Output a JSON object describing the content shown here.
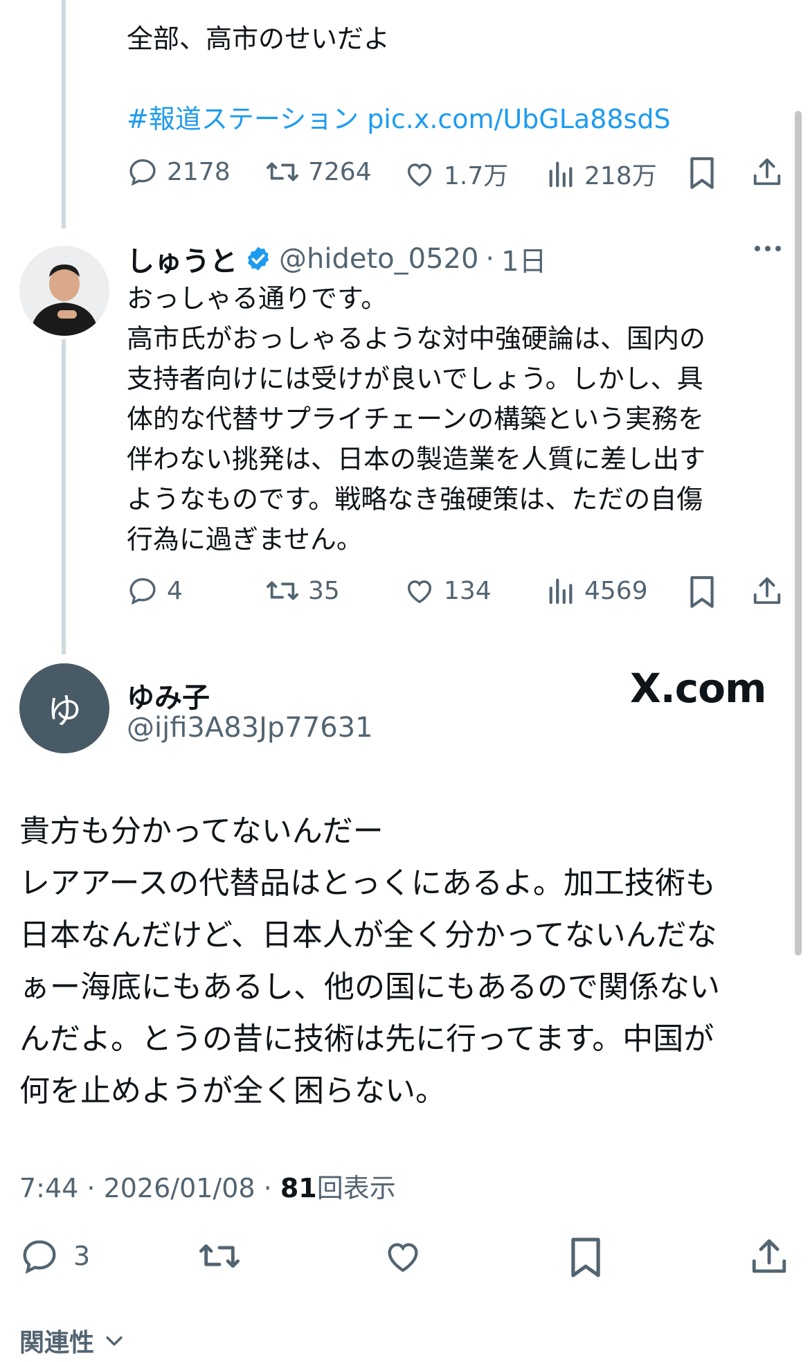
{
  "quoted_tweet": {
    "text": "全部、高市のせいだよ",
    "hashtag": "#報道ステーション",
    "link": "pic.x.com/UbGLa88sdS",
    "stats": {
      "replies": "2178",
      "retweets": "7264",
      "likes": "1.7万",
      "views": "218万"
    }
  },
  "reply_tweet": {
    "author_name": "しゅうと",
    "author_handle": "@hideto_0520",
    "time": "1日",
    "separator": "·",
    "lines": [
      "おっしゃる通りです。",
      "高市氏がおっしゃるような対中強硬論は、国内の",
      "支持者向けには受けが良いでしょう。しかし、具",
      "体的な代替サプライチェーンの構築という実務を",
      "伴わない挑発は、日本の製造業を人質に差し出す",
      "ようなものです。戦略なき強硬策は、ただの自傷",
      "行為に過ぎません。"
    ],
    "stats": {
      "replies": "4",
      "retweets": "35",
      "likes": "134",
      "views": "4569"
    }
  },
  "main_tweet": {
    "author_name": "ゆみ子",
    "author_handle": "@ijfi3A83Jp77631",
    "avatar_letter": "ゆ",
    "watermark": "X.com",
    "lines": [
      "貴方も分かってないんだー",
      "レアアースの代替品はとっくにあるよ。加工技術も",
      "日本なんだけど、日本人が全く分かってないんだな",
      "ぁー海底にもあるし、他の国にもあるので関係ない",
      "んだよ。とうの昔に技術は先に行ってます。中国が",
      "何を止めようが全く困らない。"
    ],
    "meta_time": "7:44 · 2026/01/08 · ",
    "meta_views_count": "81",
    "meta_views_label": "回表示",
    "stats": {
      "replies": "3"
    }
  },
  "footer": {
    "sort_label": "関連性"
  },
  "colors": {
    "link": "#1d9bf0",
    "verified": "#1d9bf0",
    "muted": "#536471",
    "text": "#0f1419",
    "avatar_bg": "#495a67"
  },
  "icons": [
    "reply-icon",
    "retweet-icon",
    "like-icon",
    "views-icon",
    "bookmark-icon",
    "share-icon",
    "verified-badge-icon",
    "more-icon",
    "chevron-down-icon"
  ]
}
